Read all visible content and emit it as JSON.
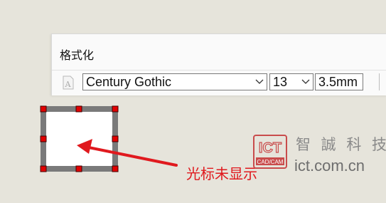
{
  "format_panel": {
    "title": "格式化",
    "font_name": "Century Gothic",
    "font_size": "13",
    "char_width": "3.5mm",
    "font_icon": "font-style-icon",
    "dropdown_icon": "chevron-down-icon"
  },
  "canvas": {
    "selection_handles_color": "#e10000",
    "frame_color": "#7a7a7a"
  },
  "annotation": {
    "text": "光标未显示",
    "color": "#e0191e"
  },
  "watermark": {
    "logo_letters": "ICT",
    "logo_sub": "CAD/CAM",
    "name": "智 誠 科 技",
    "url": "ict.com.cn"
  }
}
